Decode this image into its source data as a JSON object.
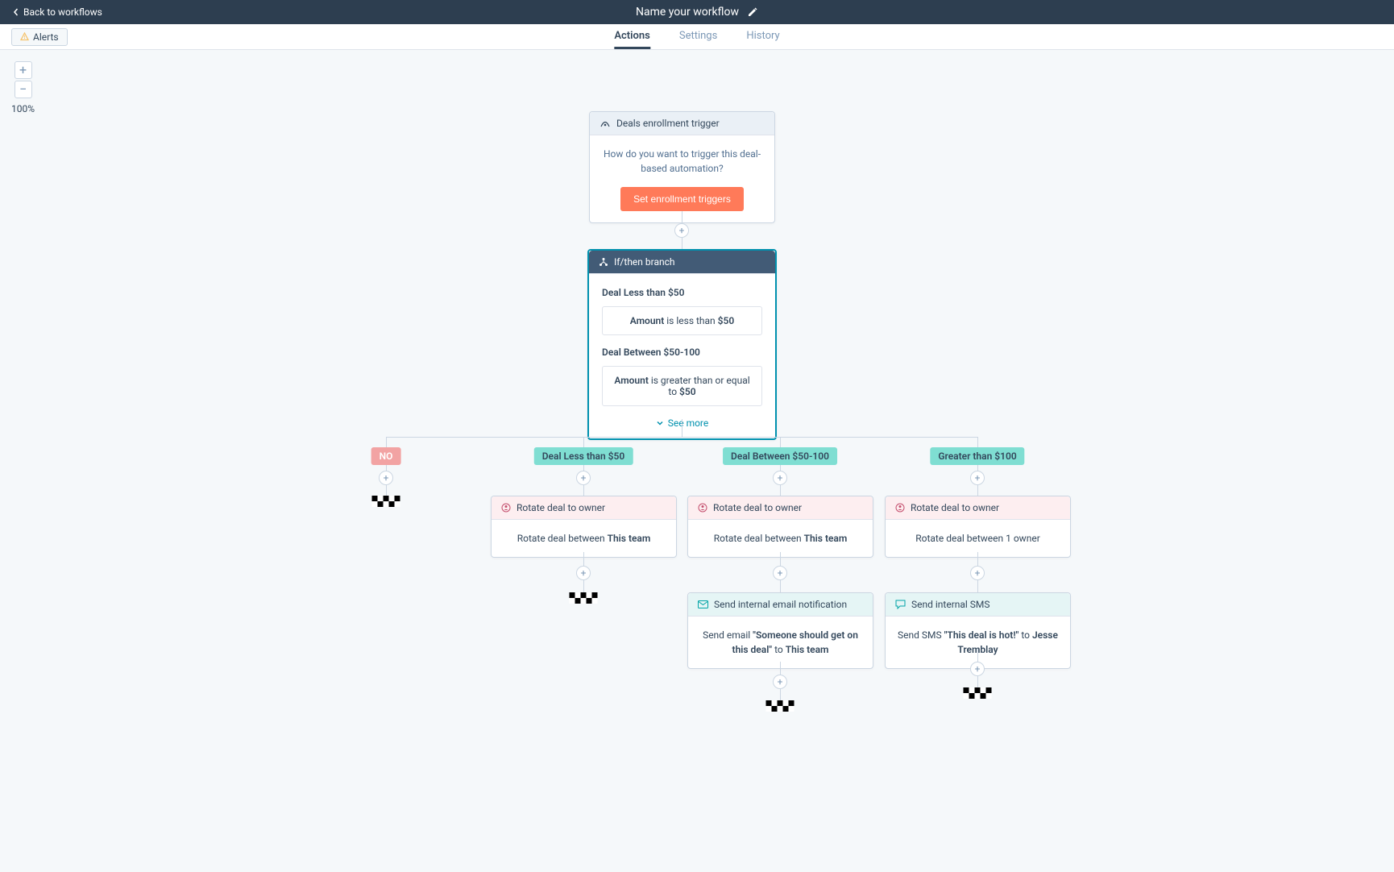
{
  "header": {
    "back_label": "Back to workflows",
    "title": "Name your workflow"
  },
  "toolbar": {
    "alerts_label": "Alerts"
  },
  "tabs": {
    "actions": "Actions",
    "settings": "Settings",
    "history": "History"
  },
  "zoom": {
    "percent": "100%"
  },
  "trigger": {
    "header": "Deals enrollment trigger",
    "prompt": "How do you want to trigger this deal-based automation?",
    "button": "Set enrollment triggers"
  },
  "branch": {
    "header": "If/then branch",
    "group1_title": "Deal Less than $50",
    "cond1_field": "Amount",
    "cond1_mid": " is less than ",
    "cond1_val": "$50",
    "group2_title": "Deal Between $50-100",
    "cond2_field": "Amount",
    "cond2_mid": " is greater than or equal to ",
    "cond2_val": "$50",
    "see_more": "See more"
  },
  "labels": {
    "no": "NO",
    "less50": "Deal Less than $50",
    "between": "Deal Between $50-100",
    "greater100": "Greater than $100"
  },
  "rotate": {
    "header": "Rotate deal to owner",
    "body_prefix": "Rotate deal between ",
    "team": "This team",
    "single_owner_full": "Rotate deal between 1 owner"
  },
  "email": {
    "header": "Send internal email notification",
    "pre": "Send email ",
    "quoted": "\"Someone should get on this deal\"",
    "mid": " to ",
    "team": "This team"
  },
  "sms": {
    "header": "Send internal SMS",
    "pre": "Send SMS ",
    "quoted": "\"This deal is hot!\"",
    "mid": " to ",
    "person": "Jesse Tremblay"
  }
}
